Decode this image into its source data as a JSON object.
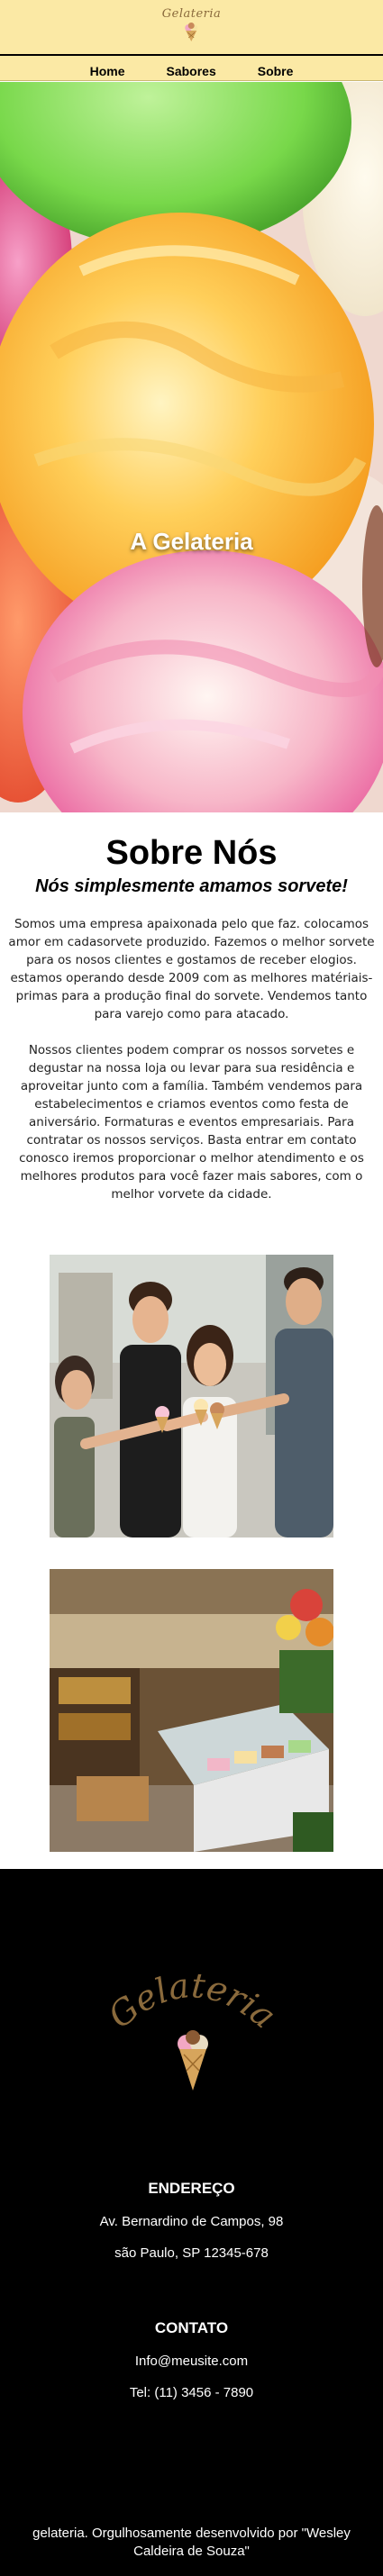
{
  "header": {
    "logo_text": "Gelateria",
    "nav": {
      "home": "Home",
      "flavors": "Sabores",
      "about": "Sobre"
    }
  },
  "hero": {
    "title": "A Gelateria"
  },
  "about": {
    "title": "Sobre Nós",
    "subtitle": "Nós simplesmente amamos sorvete!",
    "paragraph_1": "Somos uma empresa apaixonada pelo que faz. colocamos amor em cadasorvete produzido. Fazemos o melhor sorvete para os nosos clientes e gostamos de receber elogios. estamos operando desde 2009 com as melhores matériais-primas para a produção final do sorvete. Vendemos tanto para varejo como para atacado.",
    "paragraph_2": "Nossos clientes podem comprar os nossos sorvetes e degustar na nossa loja ou levar para sua residência e aproveitar junto com a família. Também vendemos para estabelecimentos e criamos eventos como festa de aniversário. Formaturas e eventos empresariais. Para contratar os nossos serviços. Basta entrar em contato conosco iremos proporcionar o melhor atendimento e os melhores produtos para você fazer mais sabores, com o melhor vorvete da cidade."
  },
  "footer": {
    "logo_text": "Gelateria",
    "address_heading": "ENDEREÇO",
    "address_line_1": "Av. Bernardino de Campos, 98",
    "address_line_2": "são Paulo, SP 12345-678",
    "contact_heading": "CONTATO",
    "email": "Info@meusite.com",
    "phone": "Tel: (11) 3456 - 7890",
    "copyright": "gelateria. Orgulhosamente desenvolvido por \"Wesley Caldeira de Souza\""
  },
  "colors": {
    "header_bg": "#fbe9a5",
    "footer_bg": "#000000",
    "logo_brown": "#8a6a3c"
  }
}
